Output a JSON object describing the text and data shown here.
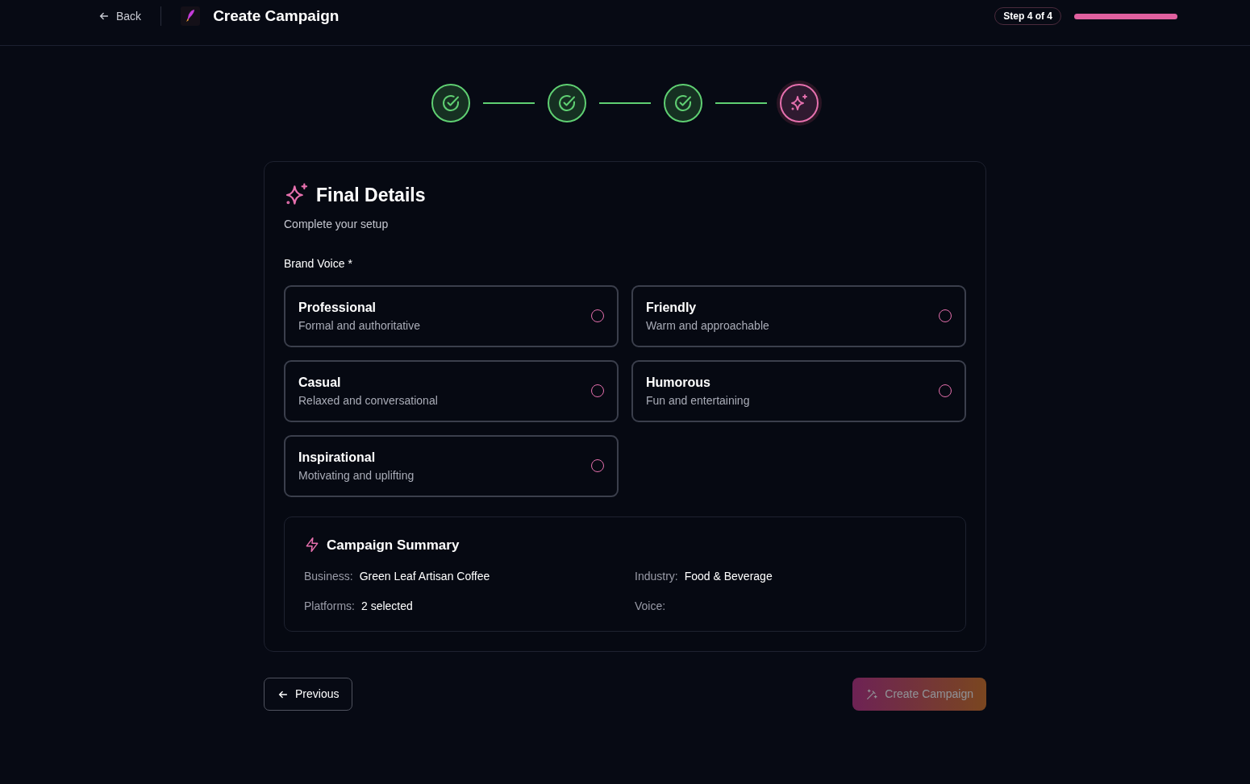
{
  "header": {
    "back": "Back",
    "title": "Create Campaign",
    "step_label": "Step 4 of 4",
    "progress": {
      "level": 1
    }
  },
  "steps": [
    {
      "kind": "done"
    },
    {
      "kind": "done"
    },
    {
      "kind": "done"
    },
    {
      "kind": "current"
    }
  ],
  "card": {
    "title": "Final Details",
    "subtitle": "Complete your setup",
    "field_label": "Brand Voice *",
    "options": [
      {
        "title": "Professional",
        "description": "Formal and authoritative",
        "selected": false
      },
      {
        "title": "Friendly",
        "description": "Warm and approachable",
        "selected": false
      },
      {
        "title": "Casual",
        "description": "Relaxed and conversational",
        "selected": false
      },
      {
        "title": "Humorous",
        "description": "Fun and entertaining",
        "selected": false
      },
      {
        "title": "Inspirational",
        "description": "Motivating and uplifting",
        "selected": false
      }
    ],
    "summary": {
      "title": "Campaign Summary",
      "items": [
        {
          "label": "Business:",
          "value": "Green Leaf Artisan Coffee"
        },
        {
          "label": "Industry:",
          "value": "Food & Beverage"
        },
        {
          "label": "Platforms:",
          "value": "2 selected"
        },
        {
          "label": "Voice:"
        }
      ]
    }
  },
  "footer": {
    "previous": "Previous",
    "create": {
      "label": "Create Campaign",
      "disabled": true
    }
  }
}
